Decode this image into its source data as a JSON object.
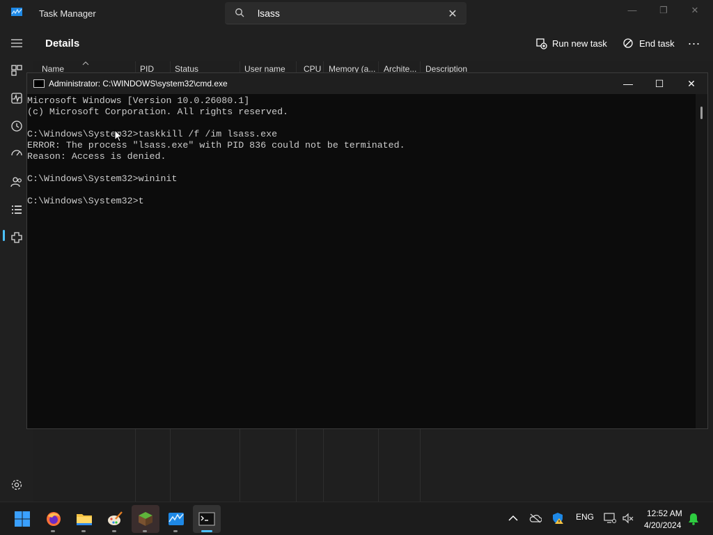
{
  "task_manager": {
    "title": "Task Manager",
    "search": {
      "value": "lsass"
    },
    "page_title": "Details",
    "actions": {
      "run_new_task": "Run new task",
      "end_task": "End task",
      "more": "..."
    },
    "columns": [
      "Name",
      "PID",
      "Status",
      "User name",
      "CPU",
      "Memory (a...",
      "Archite...",
      "Description"
    ],
    "nav_items": [
      "processes-icon",
      "performance-icon",
      "app-history-icon",
      "startup-apps-icon",
      "users-icon",
      "details-icon",
      "services-icon"
    ],
    "active_nav": "details-icon"
  },
  "console": {
    "title": "Administrator: C:\\WINDOWS\\system32\\cmd.exe",
    "lines": [
      "Microsoft Windows [Version 10.0.26080.1]",
      "(c) Microsoft Corporation. All rights reserved.",
      "",
      "C:\\Windows\\System32>taskkill /f /im lsass.exe",
      "ERROR: The process \"lsass.exe\" with PID 836 could not be terminated.",
      "Reason: Access is denied.",
      "",
      "C:\\Windows\\System32>wininit",
      "",
      "C:\\Windows\\System32>t"
    ]
  },
  "taskbar": {
    "apps": [
      "start-icon",
      "firefox-icon",
      "file-explorer-icon",
      "paint-icon",
      "minecraft-icon",
      "task-manager-icon",
      "terminal-icon"
    ],
    "tray": {
      "language": "ENG"
    },
    "clock": {
      "time": "12:52 AM",
      "date": "4/20/2024"
    }
  },
  "colors": {
    "accent": "#4cc2ff",
    "console_bg": "#0c0c0c",
    "console_text": "#cccccc",
    "notification": "#2ecc40"
  }
}
